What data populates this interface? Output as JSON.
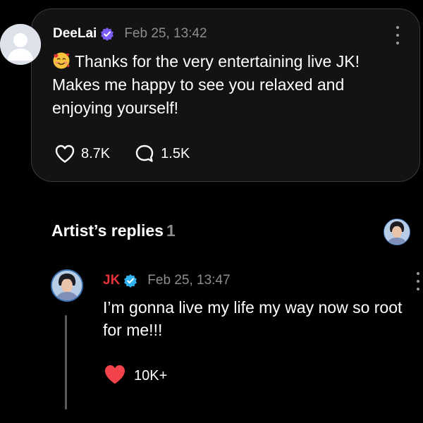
{
  "post": {
    "username": "DeeLai",
    "timestamp": "Feb 25, 13:42",
    "emoji": "smiling-face-with-hearts",
    "text": "Thanks for the very entertaining live JK! Makes me happy to see you relaxed and enjoying yourself!",
    "likes": "8.7K",
    "comments": "1.5K",
    "verified_color": "#7b5cf5"
  },
  "artist_replies": {
    "heading": "Artist’s replies",
    "count": "1"
  },
  "reply": {
    "username": "JK",
    "username_color": "#e8323a",
    "timestamp": "Feb 25, 13:47",
    "text": "I’m gonna live my life my way now so root for me!!!",
    "likes": "10K+",
    "like_color": "#f2434b",
    "verified_color": "#2fb2f0"
  },
  "icons": {
    "post_verified": "verified-badge-icon",
    "reply_verified": "verified-badge-icon",
    "post_like": "heart-outline-icon",
    "post_comment": "comment-bubble-icon",
    "reply_like": "heart-filled-icon",
    "menu": "more-vertical-icon"
  }
}
